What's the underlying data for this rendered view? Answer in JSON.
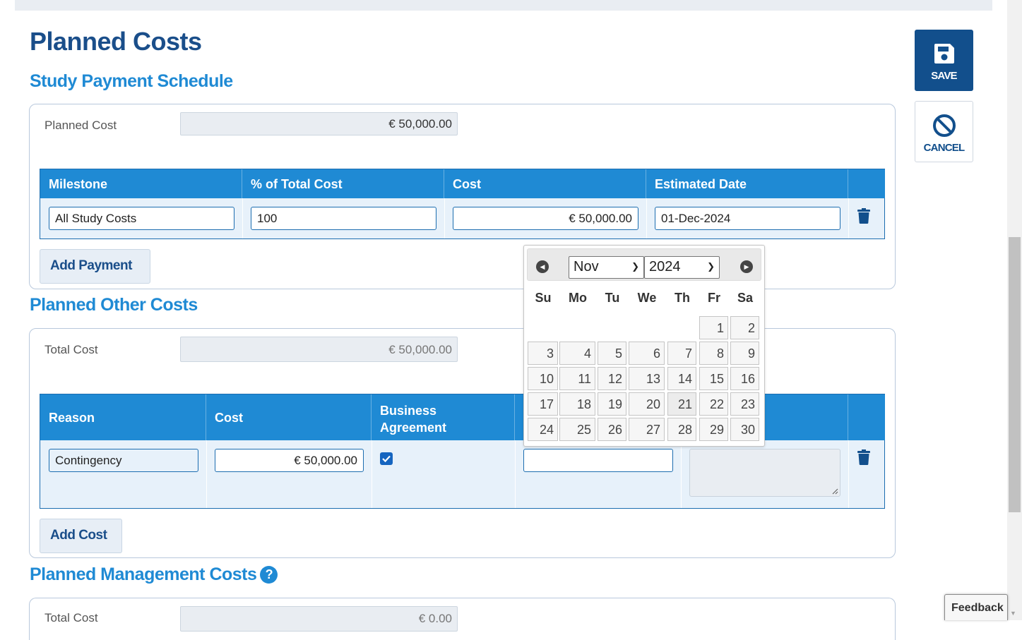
{
  "page": {
    "title": "Planned Costs"
  },
  "actions": {
    "save_label": "SAVE",
    "cancel_label": "CANCEL"
  },
  "payment_schedule": {
    "title": "Study Payment Schedule",
    "planned_cost_label": "Planned Cost",
    "planned_cost_value": "€ 50,000.00",
    "columns": [
      "Milestone",
      "% of Total Cost",
      "Cost",
      "Estimated Date"
    ],
    "row": {
      "milestone": "All Study Costs",
      "percent": "100",
      "cost": "€ 50,000.00",
      "date": "01-Dec-2024"
    },
    "add_label": "Add Payment"
  },
  "other_costs": {
    "title": "Planned Other Costs",
    "total_label": "Total Cost",
    "total_value": "€ 50,000.00",
    "columns": [
      "Reason",
      "Cost",
      "Business Agreement"
    ],
    "row": {
      "reason": "Contingency",
      "cost": "€ 50,000.00",
      "business_agreement": true,
      "date": ""
    },
    "add_label": "Add Cost"
  },
  "management_costs": {
    "title": "Planned Management Costs",
    "total_label": "Total Cost",
    "total_value": "€ 0.00"
  },
  "datepicker": {
    "month": "Nov",
    "year": "2024",
    "weekdays": [
      "Su",
      "Mo",
      "Tu",
      "We",
      "Th",
      "Fr",
      "Sa"
    ],
    "days": [
      "1",
      "2",
      "3",
      "4",
      "5",
      "6",
      "7",
      "8",
      "9",
      "10",
      "11",
      "12",
      "13",
      "14",
      "15",
      "16",
      "17",
      "18",
      "19",
      "20",
      "21",
      "22",
      "23",
      "24",
      "25",
      "26",
      "27",
      "28",
      "29",
      "30"
    ]
  },
  "feedback_label": "Feedback",
  "colors": {
    "primary": "#124f8c",
    "accent": "#1f8ad4",
    "table_header": "#1f8ad4"
  }
}
